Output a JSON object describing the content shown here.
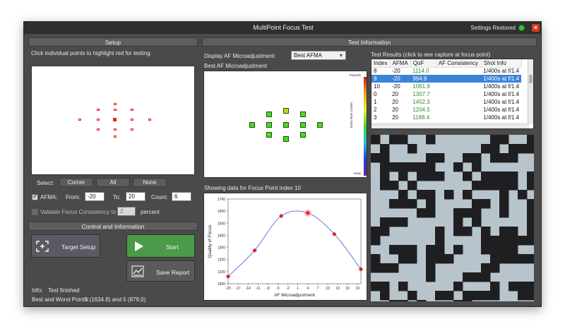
{
  "window": {
    "title": "MultiPoint Focus Test",
    "settings_status": "Settings Restored",
    "close_glyph": "×"
  },
  "setup": {
    "header": "Setup",
    "instruction": "Click individual points to highlight red for testing.",
    "select_label": "Select:",
    "corner_label": "Corner",
    "all_label": "All",
    "none_label": "None",
    "afma_label": "AFMA:",
    "afma_checked": true,
    "from_label": "From:",
    "from_value": "-20",
    "to_label": "To:",
    "to_value": "20",
    "count_label": "Count:",
    "count_value": "6",
    "validate_label": "Validate Focus Consistency to",
    "validate_checked": false,
    "validate_value": "2",
    "percent_label": "percent"
  },
  "control": {
    "header": "Control and Information",
    "target_setup_label": "Target Setup",
    "start_label": "Start",
    "save_report_label": "Save Report",
    "info_label": "Info:",
    "info_value": "Test finished",
    "best_worst_label": "Best and Worst Points:",
    "best_worst_value": "5 (1634.8) and 5 (879.0)",
    "start_color": "#4a9a4a"
  },
  "test_info": {
    "header": "Test Information",
    "display_label": "Display AF Microadjustment:",
    "display_value": "Best AFMA",
    "best_afma_title": "Best AF Microadjustment",
    "colorbar_top": "Towards",
    "colorbar_mid": "Extra Rear Center",
    "colorbar_bottom": "Away",
    "graph_title": "Showing data for Focus Point index 10"
  },
  "results": {
    "header": "Test Results (click to see capture at focus point)",
    "columns": [
      "Index",
      "AFMA",
      "QoF",
      "AF Consistency",
      "Shot Info"
    ],
    "rows": [
      {
        "index": "8",
        "afma": "-20",
        "qof": "1114.0",
        "consistency": "",
        "shot": "1/400s at f/1.4",
        "selected": false
      },
      {
        "index": "9",
        "afma": "-20",
        "qof": "994.9",
        "consistency": "",
        "shot": "1/400s at f/1.4",
        "selected": true
      },
      {
        "index": "10",
        "afma": "-20",
        "qof": "1061.9",
        "consistency": "",
        "shot": "1/400s at f/1.4",
        "selected": false
      },
      {
        "index": "0",
        "afma": "20",
        "qof": "1307.7",
        "consistency": "",
        "shot": "1/400s at f/1.4",
        "selected": false
      },
      {
        "index": "1",
        "afma": "20",
        "qof": "1452.3",
        "consistency": "",
        "shot": "1/400s at f/1.4",
        "selected": false
      },
      {
        "index": "2",
        "afma": "20",
        "qof": "1204.5",
        "consistency": "",
        "shot": "1/400s at f/1.4",
        "selected": false
      },
      {
        "index": "3",
        "afma": "20",
        "qof": "1188.4",
        "consistency": "",
        "shot": "1/400s at f/1.4",
        "selected": false
      }
    ]
  },
  "chart_data": {
    "type": "scatter",
    "xlabel": "AF Microadjustment",
    "ylabel": "Quality of Focus",
    "xlim": [
      -20,
      20
    ],
    "ylim": [
      1000,
      1700
    ],
    "xticks": [
      -20,
      -17,
      -14,
      -11,
      -8,
      -5,
      -2,
      1,
      4,
      7,
      10,
      13,
      16,
      19
    ],
    "yticks": [
      1000,
      1100,
      1200,
      1300,
      1400,
      1500,
      1600,
      1700
    ],
    "points": [
      {
        "x": -20,
        "y": 1060
      },
      {
        "x": -12,
        "y": 1275
      },
      {
        "x": -4,
        "y": 1560
      },
      {
        "x": 4,
        "y": 1585
      },
      {
        "x": 12,
        "y": 1410
      },
      {
        "x": 20,
        "y": 1120
      }
    ],
    "highlight": {
      "x": 4,
      "y": 1585
    },
    "curve_color": "#5566dd",
    "point_color": "#e02020"
  },
  "icons": {
    "close": "close-icon",
    "status": "status-dot-icon",
    "target": "target-icon",
    "start": "play-icon",
    "report": "report-icon",
    "dropdown": "chevron-down-icon"
  }
}
